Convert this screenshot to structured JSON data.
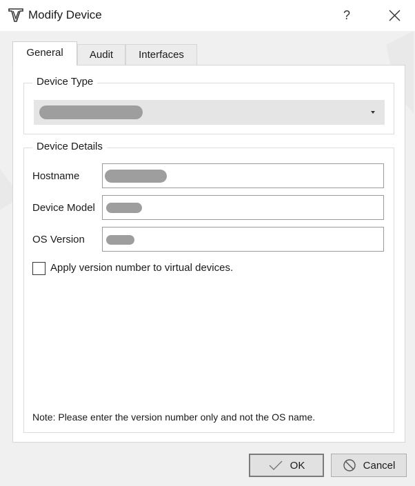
{
  "window": {
    "title": "Modify Device",
    "help_label": "?",
    "close_icon": "close-icon",
    "app_icon": "vt-logo-icon"
  },
  "tabs": [
    {
      "label": "General",
      "active": true
    },
    {
      "label": "Audit",
      "active": false
    },
    {
      "label": "Interfaces",
      "active": false
    }
  ],
  "device_type": {
    "group_title": "Device Type",
    "selected_value": ""
  },
  "device_details": {
    "group_title": "Device Details",
    "hostname_label": "Hostname",
    "hostname_value": "",
    "device_model_label": "Device Model",
    "device_model_value": "",
    "os_version_label": "OS Version",
    "os_version_value": "",
    "apply_checkbox_label": "Apply version number to virtual devices.",
    "apply_checked": false
  },
  "note": "Note: Please enter the version number only and not the OS name.",
  "buttons": {
    "ok_label": "OK",
    "cancel_label": "Cancel"
  },
  "colors": {
    "window_bg": "#f0f0f0",
    "panel_bg": "#ffffff",
    "redacted_fill": "#9e9e9e"
  }
}
